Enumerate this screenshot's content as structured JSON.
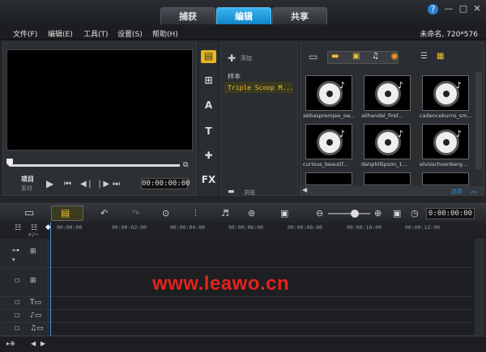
{
  "tabs": [
    {
      "label": "捕获",
      "active": false
    },
    {
      "label": "编辑",
      "active": true
    },
    {
      "label": "共享",
      "active": false
    }
  ],
  "window_buttons": [
    "?",
    "—",
    "□",
    "✕"
  ],
  "menu": [
    "文件(F)",
    "编辑(E)",
    "工具(T)",
    "设置(S)",
    "帮助(H)"
  ],
  "project_info": "未命名, 720*576",
  "preview": {
    "mode_top": "项目",
    "mode_bottom": "素材",
    "timecode": "00:00:00:00"
  },
  "library": {
    "add_label": "添加",
    "categories": [
      "样本",
      "Triple Scoop M..."
    ],
    "thumbnails": [
      "abbaspremjee_sw...",
      "alihandal_firef...",
      "cadenceburns_sm...",
      "curious_beautif...",
      "danphillipson_1...",
      "elvisschoenberg..."
    ],
    "browse_label": "浏览",
    "options_label": "选项"
  },
  "timeline": {
    "timecode": "0:00:00:00",
    "ticks": [
      "00:00:00",
      "00:00:02:00",
      "00:00:04:00",
      "00:00:06:00",
      "00:00:08:00",
      "00:00:10:00",
      "00:00:12:00"
    ]
  },
  "watermark": "www.leawo.cn",
  "colors": {
    "accent": "#1ca0e6",
    "watermark": "#e5231b"
  }
}
